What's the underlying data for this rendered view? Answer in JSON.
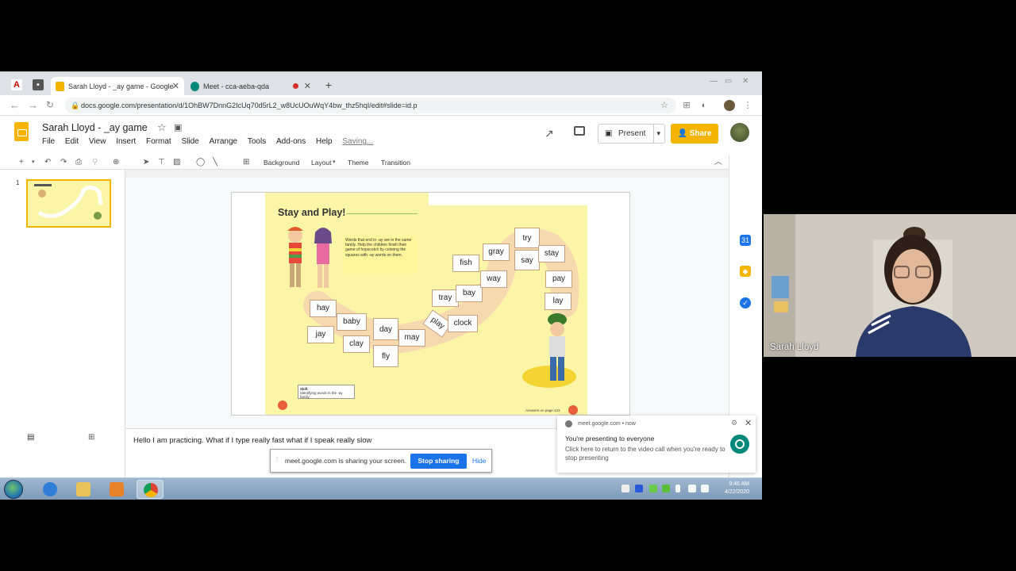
{
  "browser": {
    "tabs": [
      {
        "label": "Sarah Lloyd - _ay game - Google",
        "active": true
      },
      {
        "label": "Meet - cca-aeba-qda",
        "active": false
      }
    ],
    "url": "docs.google.com/presentation/d/1OhBW7DnnG2IcUq70d5rL2_w8UcUOuWqY4bw_thz5hqI/edit#slide=id.p"
  },
  "slides_app": {
    "title": "Sarah Lloyd - _ay game",
    "menu": [
      "File",
      "Edit",
      "View",
      "Insert",
      "Format",
      "Slide",
      "Arrange",
      "Tools",
      "Add-ons",
      "Help"
    ],
    "save_status": "Saving...",
    "present_label": "Present",
    "share_label": "Share",
    "toolbar": {
      "background": "Background",
      "layout": "Layout",
      "theme": "Theme",
      "transition": "Transition"
    },
    "slide_number": "1",
    "accent_color": "#f4b400"
  },
  "slide": {
    "heading": "Stay and Play!",
    "instructions": "Words that end in -ay are in the same family. Help the children finish their game of hopscotch by coloring the squares with -ay words on them.",
    "words": [
      "hay",
      "baby",
      "jay",
      "clay",
      "day",
      "fly",
      "may",
      "play",
      "clock",
      "tray",
      "bay",
      "way",
      "fish",
      "gray",
      "try",
      "say",
      "stay",
      "pay",
      "lay"
    ],
    "skill_title": "Skill:",
    "skill_text": "Identifying words in the -ay family",
    "answers": "Answers on page 123"
  },
  "speaker_notes": "Hello I am practicing.  What if I type really fast what if I speak really slow",
  "sharing_bar": {
    "message": "meet.google.com is sharing your screen.",
    "stop_label": "Stop sharing",
    "hide_label": "Hide"
  },
  "notification": {
    "source": "meet.google.com  •  now",
    "title": "You're presenting to everyone",
    "body": "Click here to return to the video call when you're ready to stop presenting"
  },
  "taskbar": {
    "time": "9:46 AM",
    "date": "4/22/2020"
  },
  "webcam": {
    "participant_name": "Sarah Lloyd"
  }
}
